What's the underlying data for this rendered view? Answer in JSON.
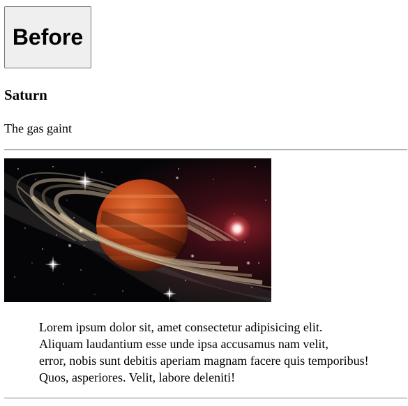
{
  "button": {
    "label": "Before"
  },
  "heading": {
    "title": "Saturn",
    "subtitle": "The gas gaint"
  },
  "image": {
    "subject": "saturn-ringed-planet"
  },
  "paragraph": {
    "text": "Lorem ipsum dolor sit, amet consectetur adipisicing elit.\nAliquam laudantium esse unde ipsa accusamus nam velit,\nerror, nobis sunt debitis aperiam magnam facere quis temporibus!\nQuos, asperiores. Velit, labore deleniti!"
  },
  "colors": {
    "button_bg": "#efefef",
    "button_border": "#767676",
    "rule": "#a0a0a0",
    "planet_orange": "#c9561f",
    "space_bg": "#050508"
  }
}
